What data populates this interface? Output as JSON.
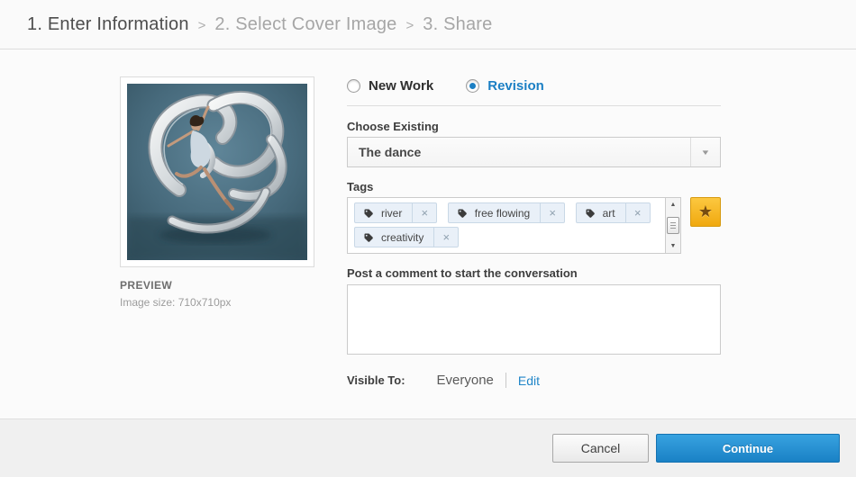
{
  "breadcrumb": {
    "separator": ">",
    "steps": [
      {
        "label": "1. Enter Information",
        "state": "active"
      },
      {
        "label": "2. Select Cover Image",
        "state": "upcoming"
      },
      {
        "label": "3. Share",
        "state": "upcoming"
      }
    ]
  },
  "preview": {
    "label": "PREVIEW",
    "image_size_text": "Image size: 710x710px"
  },
  "form": {
    "work_type": {
      "options": [
        {
          "label": "New Work",
          "selected": false
        },
        {
          "label": "Revision",
          "selected": true
        }
      ]
    },
    "choose_existing": {
      "label": "Choose Existing",
      "value": "The dance"
    },
    "tags": {
      "label": "Tags",
      "items": [
        "river",
        "free flowing",
        "art",
        "creativity"
      ],
      "remove_glyph": "×"
    },
    "comment": {
      "label": "Post a comment to start the conversation",
      "value": ""
    },
    "visibility": {
      "label": "Visible To:",
      "value": "Everyone",
      "edit_label": "Edit"
    }
  },
  "footer": {
    "cancel_label": "Cancel",
    "continue_label": "Continue"
  },
  "icons": {
    "star": "★",
    "dropdown_arrow": "▼",
    "scroll_up": "▲",
    "scroll_down": "▼"
  },
  "colors": {
    "accent_blue": "#1b7fc4",
    "link_blue": "#2186c8",
    "star_gold_top": "#fcc840",
    "star_gold_bottom": "#f0a90f",
    "continue_blue_top": "#37a2e0",
    "continue_blue_bottom": "#1a81c5",
    "tag_chip_bg": "#e9f0f8",
    "tag_chip_border": "#c9d8e6"
  }
}
